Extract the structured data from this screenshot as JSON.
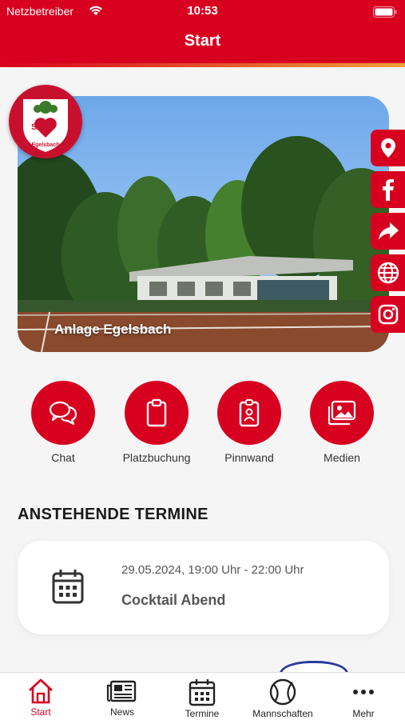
{
  "status_bar": {
    "carrier": "Netzbetreiber",
    "time": "10:53"
  },
  "header": {
    "title": "Start"
  },
  "hero": {
    "caption": "Anlage Egelsbach",
    "logo_text": "Egelsbach",
    "logo_letters": "S G"
  },
  "side_buttons": [
    {
      "icon": "location-pin-icon"
    },
    {
      "icon": "facebook-icon"
    },
    {
      "icon": "share-icon"
    },
    {
      "icon": "globe-icon"
    },
    {
      "icon": "instagram-icon"
    }
  ],
  "actions": [
    {
      "label": "Chat",
      "icon": "chat-bubbles-icon"
    },
    {
      "label": "Platzbuchung",
      "icon": "clipboard-icon"
    },
    {
      "label": "Pinnwand",
      "icon": "badge-icon"
    },
    {
      "label": "Medien",
      "icon": "images-icon"
    }
  ],
  "section": {
    "title": "ANSTEHENDE TERMINE"
  },
  "event": {
    "date": "29.05.2024, 19:00 Uhr - 22:00 Uhr",
    "name": "Cocktail Abend"
  },
  "tabbar": {
    "items": [
      {
        "label": "Start",
        "icon": "home-icon",
        "active": true
      },
      {
        "label": "News",
        "icon": "newspaper-icon",
        "active": false
      },
      {
        "label": "Termine",
        "icon": "calendar-icon",
        "active": false
      },
      {
        "label": "Mannschaften",
        "icon": "tennis-ball-icon",
        "active": false
      },
      {
        "label": "Mehr",
        "icon": "more-dots-icon",
        "active": false
      }
    ]
  },
  "colors": {
    "brand_red": "#d8001f",
    "accent_orange": "#f0a23a"
  }
}
